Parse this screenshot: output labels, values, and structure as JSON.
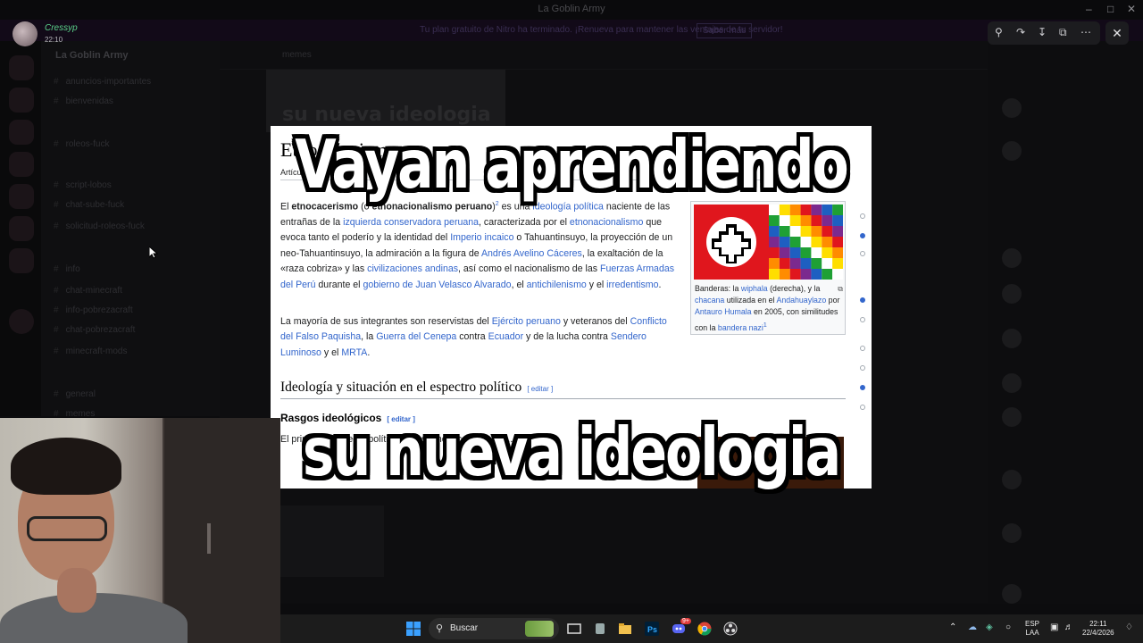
{
  "window": {
    "title": "La Goblin Army"
  },
  "banner": {
    "text": "Tu plan gratuito de Nitro ha terminado. ¡Renueva para mantener las ventajas de tu servidor!",
    "button": "Saber más"
  },
  "sidebar": {
    "server_name": "La Goblin Army",
    "channels": [
      "anuncios-importantes",
      "bienvenidas",
      "roleos-fuck",
      "script-lobos",
      "chat-sube-fuck",
      "solicitud-roleos-fuck",
      "info",
      "chat-minecraft",
      "info-pobrezacraft",
      "chat-pobrezacraft",
      "minecraft-mods",
      "general",
      "memes"
    ]
  },
  "chat": {
    "channel": "memes"
  },
  "viewer": {
    "username": "Cressyp",
    "time": "22:10"
  },
  "article": {
    "title": "Etnocacerismo",
    "tab": "Artículo",
    "p1": {
      "t0": "El ",
      "b1": "etnocacerismo",
      "t1": " (o ",
      "b2": "etnonacionalismo peruano",
      "t2": ")",
      "sup": "2",
      "t3": "  es una ",
      "l1": "ideología política",
      "t4": " naciente de las entrañas de la ",
      "l2": "izquierda conservadora peruana",
      "t5": ", caracterizada por el ",
      "l3": "etnonacionalismo",
      "t6": " que evoca tanto el poderío y la identidad del ",
      "l4": "Imperio incaico",
      "t7": " o Tahuantinsuyo, la proyección de un neo-Tahuantinsuyo, la admiración a la figura de ",
      "l5": "Andrés Avelino Cáceres",
      "t8": ", la exaltación de la «raza cobriza» y las ",
      "l6": "civilizaciones andinas",
      "t9": ", así como el nacionalismo de las ",
      "l7": "Fuerzas Armadas del Perú",
      "t10": " durante el ",
      "l8": "gobierno de Juan Velasco Alvarado",
      "t11": ", el ",
      "l9": "antichilenismo",
      "t12": " y el ",
      "l10": "irredentismo",
      "t13": "."
    },
    "p2": {
      "t0": "La mayoría de sus integrantes son reservistas del ",
      "l1": "Ejército peruano",
      "t1": " y veteranos del ",
      "l2": "Conflicto del Falso Paquisha",
      "t2": ", la ",
      "l3": "Guerra del Cenepa",
      "t3": " contra ",
      "l4": "Ecuador",
      "t4": " y de la lucha contra ",
      "l5": "Sendero Luminoso",
      "t5": " y el ",
      "l6": "MRTA",
      "t6": "."
    },
    "h2": "Ideología y situación en el espectro político",
    "h3": "Rasgos ideológicos",
    "edit": "[ editar ]",
    "p3": "El principal proyecto político de los etnocaceristas es ... español ...",
    "infobox": {
      "c0": "Banderas: la ",
      "l1": "wiphala",
      "c1": " (derecha), y la ",
      "l2": "chacana",
      "c2": " utilizada en el ",
      "l3": "Andahuaylazo",
      "c3": " por ",
      "l4": "Antauro Humala",
      "c4": " en 2005, con similitudes con la ",
      "l5": "bandera nazi",
      "sup": "1"
    }
  },
  "meme": {
    "top": "Vayan aprendiendo",
    "bottom": "su nueva ideologia"
  },
  "taskbar": {
    "search_placeholder": "Buscar",
    "language": "ESP",
    "layout": "LAA",
    "time": "22:11",
    "date": "22/4/2026",
    "discord_badge": "9+"
  },
  "colors": {
    "link": "#3366cc",
    "username": "#5bd18a",
    "taskbar": "#1c1c1c"
  }
}
